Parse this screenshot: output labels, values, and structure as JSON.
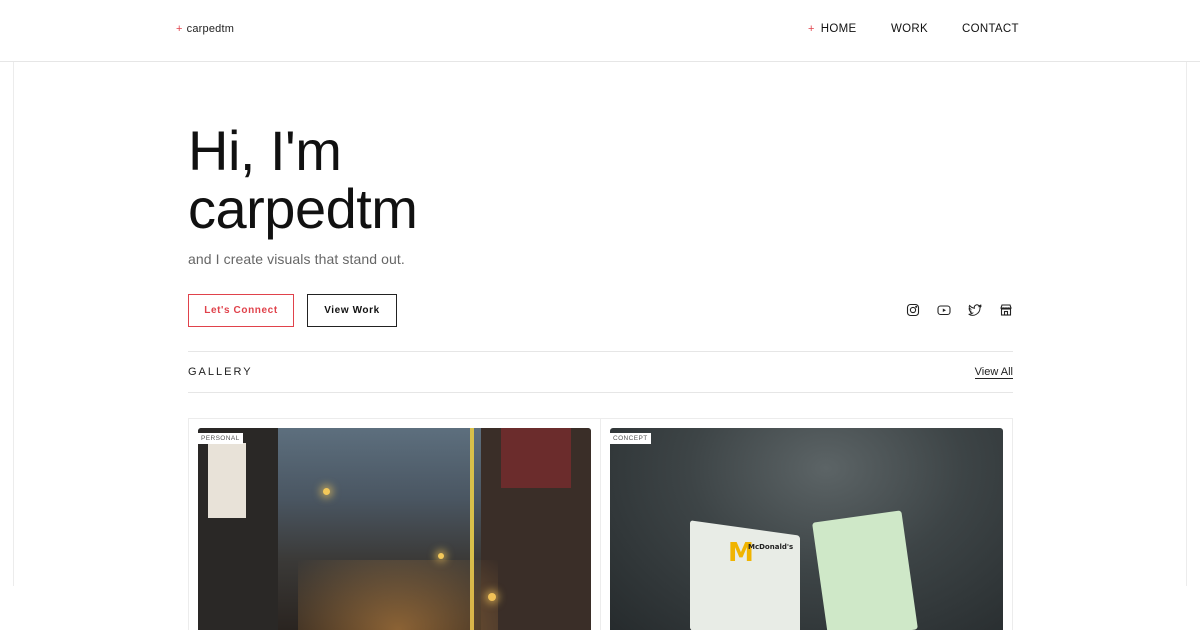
{
  "header": {
    "brand_mark": "+",
    "brand": "carpedtm",
    "nav": [
      {
        "label": "HOME",
        "active": true,
        "active_mark": "+"
      },
      {
        "label": "WORK",
        "active": false
      },
      {
        "label": "CONTACT",
        "active": false
      }
    ]
  },
  "hero": {
    "line1": "Hi, I'm",
    "line2": "carpedtm",
    "subtitle": "and I create visuals that stand out."
  },
  "actions": {
    "connect_label": "Let's Connect",
    "view_work_label": "View Work"
  },
  "social": {
    "icons": [
      "instagram-icon",
      "youtube-icon",
      "twitter-icon",
      "store-icon"
    ]
  },
  "gallery": {
    "heading": "GALLERY",
    "view_all_label": "View All",
    "cards": [
      {
        "tag": "PERSONAL"
      },
      {
        "tag": "CONCEPT",
        "logo_text": "M",
        "box_text": "McDonald's"
      }
    ]
  },
  "colors": {
    "accent": "#e0424b",
    "text": "#111111",
    "muted": "#666666",
    "border": "#e6e6e6"
  }
}
